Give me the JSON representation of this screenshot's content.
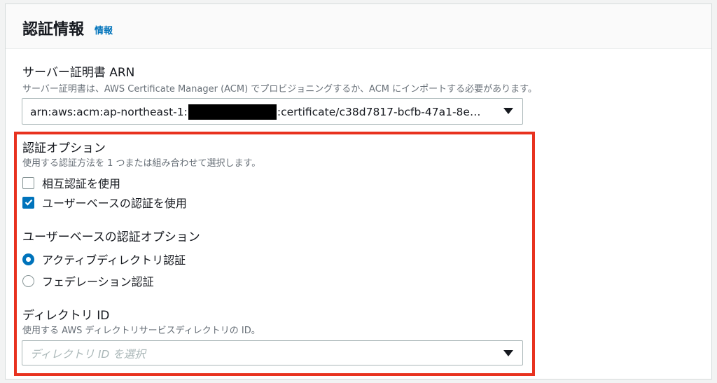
{
  "section": {
    "title": "認証情報",
    "info_link": "情報"
  },
  "server_cert": {
    "label": "サーバー証明書 ARN",
    "description": "サーバー証明書は、AWS Certificate Manager (ACM) でプロビジョニングするか、ACM にインポートする必要があります。",
    "value_prefix": "arn:aws:acm:ap-northeast-1:",
    "value_suffix": ":certificate/c38d7817-bcfb-47a1-8e…"
  },
  "auth_options": {
    "label": "認証オプション",
    "description": "使用する認証方法を 1 つまたは組み合わせて選択します。",
    "options": [
      {
        "label": "相互認証を使用",
        "checked": false
      },
      {
        "label": "ユーザーベースの認証を使用",
        "checked": true
      }
    ]
  },
  "user_auth_options": {
    "label": "ユーザーベースの認証オプション",
    "options": [
      {
        "label": "アクティブディレクトリ認証",
        "selected": true
      },
      {
        "label": "フェデレーション認証",
        "selected": false
      }
    ]
  },
  "directory_id": {
    "label": "ディレクトリ ID",
    "description": "使用する AWS ディレクトリサービスディレクトリの ID。",
    "placeholder": "ディレクトリ ID を選択"
  },
  "colors": {
    "accent": "#0073bb",
    "highlight_border": "#e8321f"
  }
}
